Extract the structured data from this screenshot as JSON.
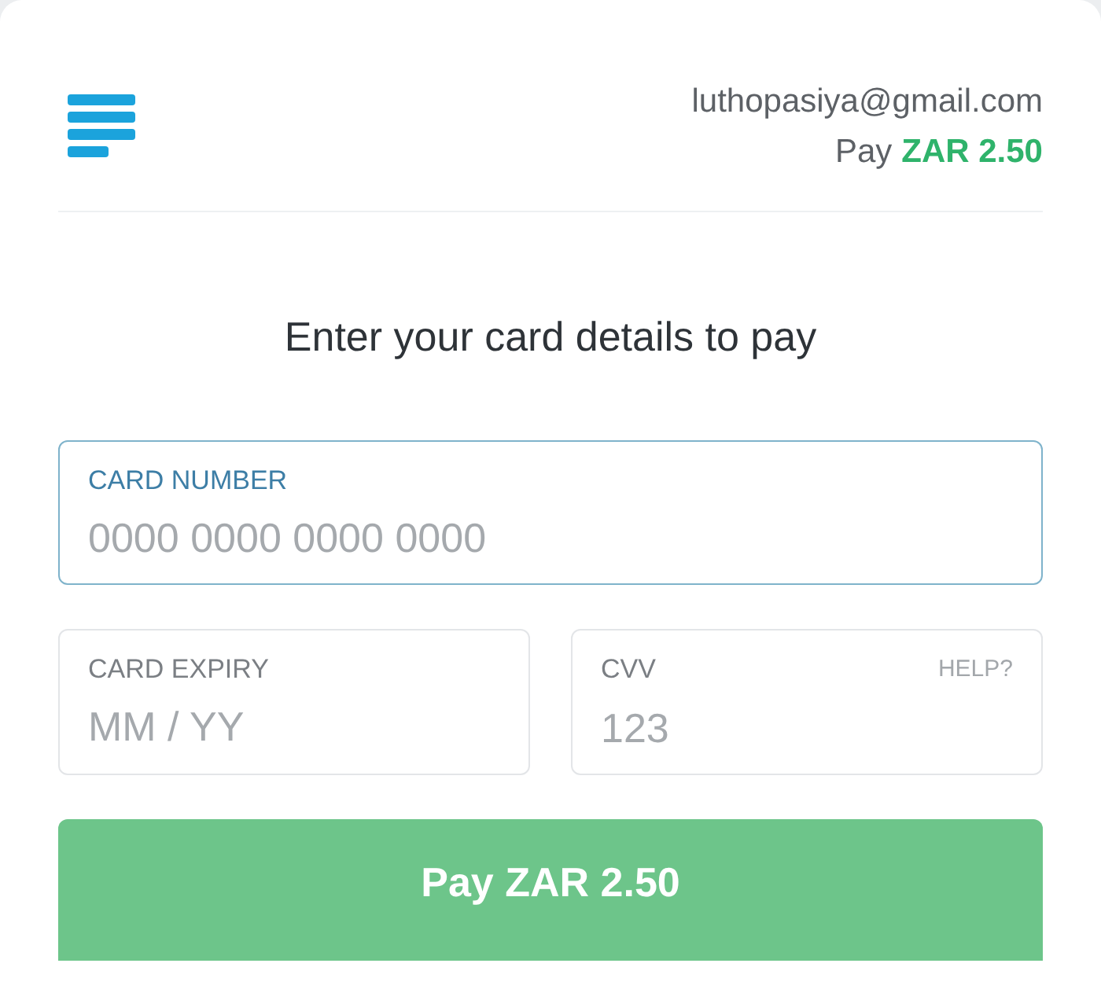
{
  "header": {
    "email": "luthopasiya@gmail.com",
    "pay_label": "Pay",
    "amount": "ZAR 2.50"
  },
  "heading": "Enter your card details to pay",
  "fields": [
    {
      "label": "CARD NUMBER",
      "placeholder": "0000 0000 0000 0000",
      "focused": true
    },
    {
      "label": "CARD EXPIRY",
      "placeholder": "MM / YY",
      "focused": false
    },
    {
      "label": "CVV",
      "placeholder": "123",
      "focused": false,
      "help": "HELP?"
    }
  ],
  "pay_button": {
    "label": "Pay ZAR 2.50"
  }
}
